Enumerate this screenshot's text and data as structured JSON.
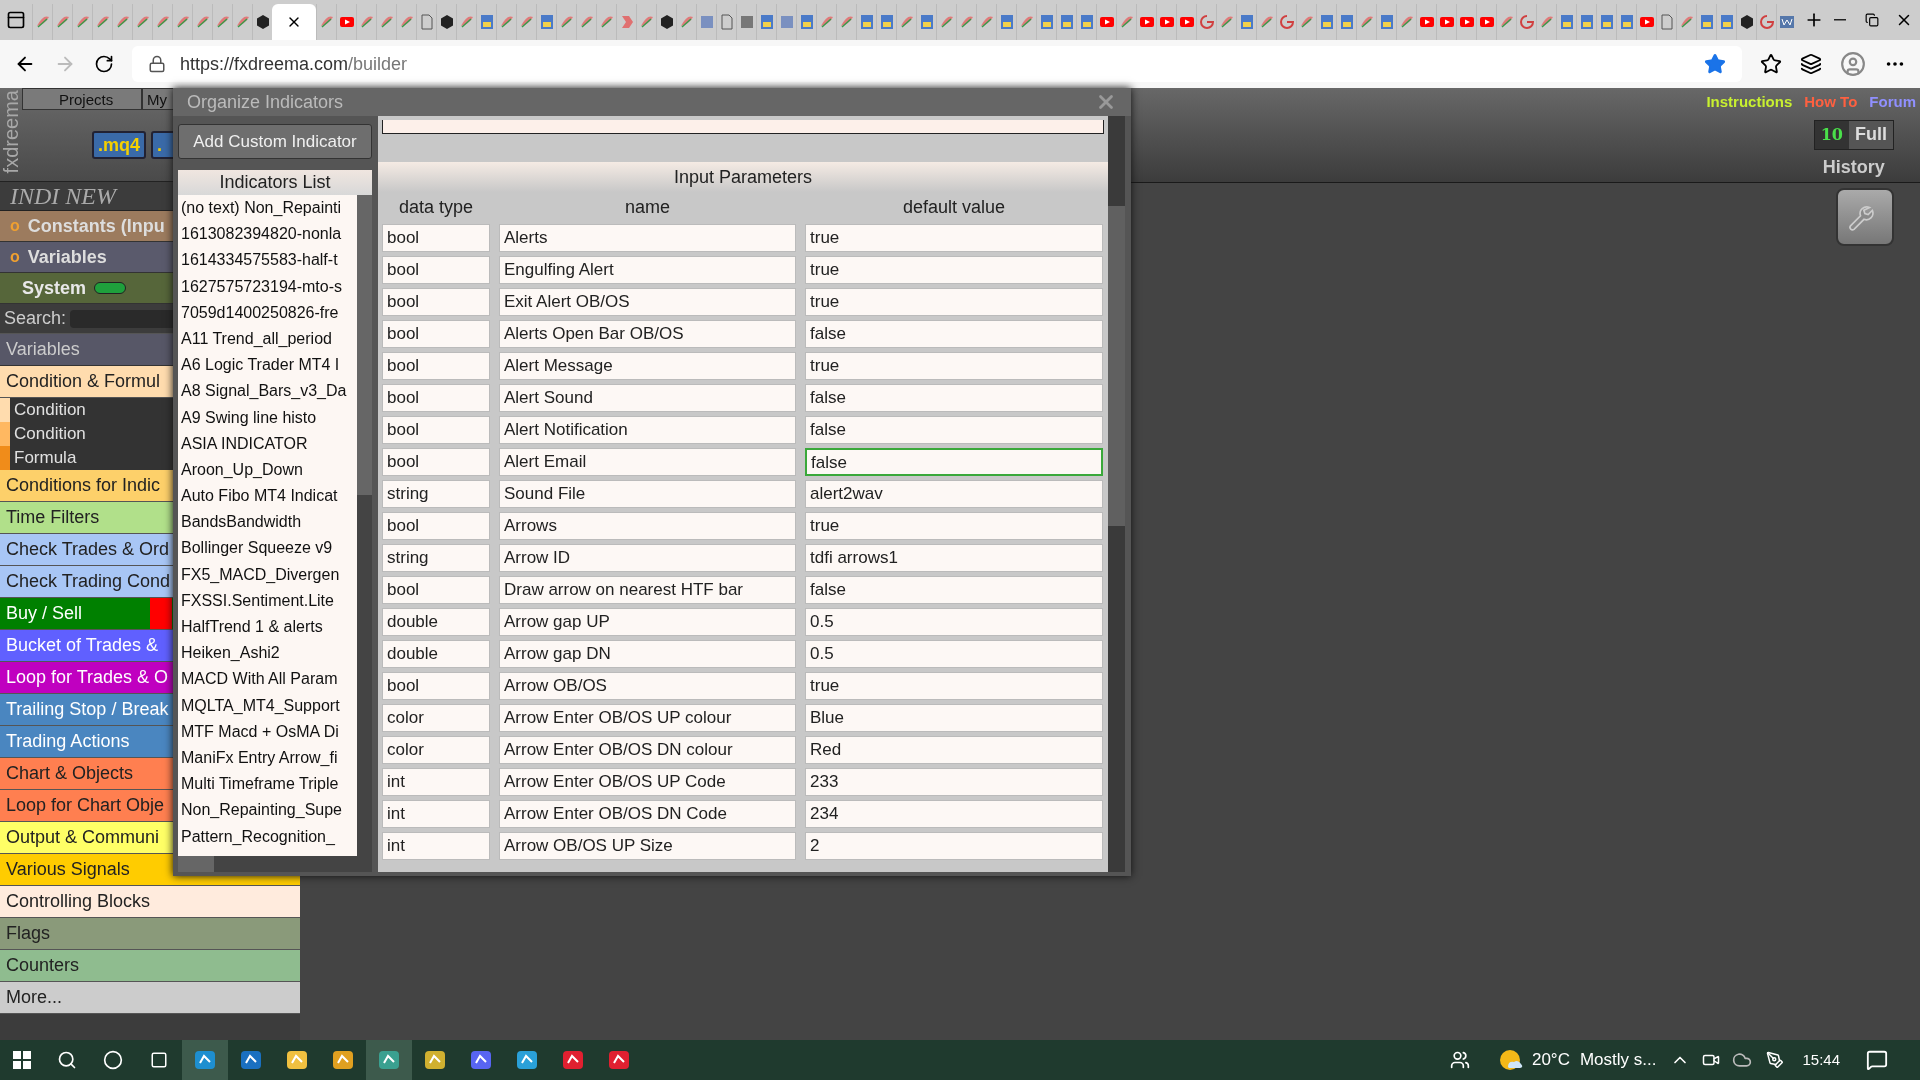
{
  "browser": {
    "url": {
      "origin": "https://fxdreema.com",
      "path": "/builder"
    }
  },
  "sidebar": {
    "brand": "fxdreema",
    "tabs": [
      {
        "label": "Projects"
      },
      {
        "label": "My"
      }
    ],
    "file_buttons": [
      ".mq4",
      "."
    ],
    "project_title": "INDI NEW",
    "sections": [
      {
        "marker": "o",
        "label": "Constants (Inpu",
        "color": "#9c7b5e"
      },
      {
        "marker": "o",
        "label": "Variables",
        "color": "#5a5a6c"
      }
    ],
    "system": {
      "label": "System",
      "on": true
    },
    "search": {
      "label": "Search:"
    },
    "variables_header": "Variables",
    "categories": [
      {
        "label": "Condition & Formul",
        "color": "#ffdcae",
        "children": [
          {
            "label": "Condition",
            "color": "#ffdcae"
          },
          {
            "label": "Condition",
            "color": "#ffb861"
          },
          {
            "label": "Formula",
            "color": "#f08c1a"
          }
        ]
      },
      {
        "label": "Conditions for Indic",
        "color": "#fdd06a"
      },
      {
        "label": "Time Filters",
        "color": "#b1e08a"
      },
      {
        "label": "Check Trades & Ord",
        "color": "#a8c6f5"
      },
      {
        "label": "Check Trading Cond",
        "color": "#a8c6f5"
      },
      {
        "label": "Buy / Sell",
        "color": "#008000",
        "flag": {
          "color": "#ff0000"
        }
      },
      {
        "label": "Bucket of Trades &",
        "color": "#6060ff"
      },
      {
        "label": "Loop for Trades & O",
        "color": "#c000c0"
      },
      {
        "label": "Trailing Stop / Break",
        "color": "#4a86c0"
      },
      {
        "label": "Trading Actions",
        "color": "#4a86c0"
      },
      {
        "label": "Chart & Objects",
        "color": "#ff7f50"
      },
      {
        "label": "Loop for Chart Obje",
        "color": "#ff7f50"
      },
      {
        "label": "Output & Communi",
        "color": "#ffff66"
      },
      {
        "label": "Various Signals",
        "color": "#ffcc00"
      },
      {
        "label": "Controlling Blocks",
        "color": "#ffebdd"
      },
      {
        "label": "Flags",
        "color": "#8a9a7a"
      },
      {
        "label": "Counters",
        "color": "#8fbc8f"
      },
      {
        "label": "More...",
        "color": "#cccccc"
      }
    ]
  },
  "toolbar": {
    "links": [
      {
        "label": "Instructions",
        "color": "#c8f030"
      },
      {
        "label": "How To",
        "color": "#ff6040"
      },
      {
        "label": "Forum",
        "color": "#9090ff"
      }
    ],
    "history_count": "10",
    "history_mode": "Full",
    "history_label": "History"
  },
  "dialog": {
    "title": "Organize Indicators",
    "add_button": "Add Custom Indicator",
    "list_title": "Indicators List",
    "indicators": [
      "(no text) Non_Repainti",
      "1613082394820-nonla",
      "1614334575583-half-t",
      "1627575723194-mto-s",
      "7059d1400250826-fre",
      "A11 Trend_all_period",
      "A6 Logic Trader MT4 I",
      "A8 Signal_Bars_v3_Da",
      "A9 Swing line histo",
      "ASIA INDICATOR",
      "Aroon_Up_Down",
      "Auto Fibo MT4 Indicat",
      "BandsBandwidth",
      "Bollinger Squeeze v9",
      "FX5_MACD_Divergen",
      "FXSSI.Sentiment.Lite",
      "HalfTrend 1 & alerts",
      "Heiken_Ashi2",
      "MACD With All Param",
      "MQLTA_MT4_Support",
      "MTF Macd + OsMA Di",
      "ManiFx Entry Arrow_fi",
      "Multi Timeframe Triple",
      "Non_Repainting_Supe",
      "Pattern_Recognition_"
    ],
    "params_title": "Input Parameters",
    "columns": [
      "data type",
      "name",
      "default value"
    ],
    "params": [
      {
        "type": "bool",
        "name": "Alerts",
        "default": "true",
        "focused": false
      },
      {
        "type": "bool",
        "name": "Engulfing Alert",
        "default": "true",
        "focused": false
      },
      {
        "type": "bool",
        "name": "Exit Alert OB/OS",
        "default": "true",
        "focused": false
      },
      {
        "type": "bool",
        "name": "Alerts Open Bar OB/OS",
        "default": "false",
        "focused": false
      },
      {
        "type": "bool",
        "name": "Alert Message",
        "default": "true",
        "focused": false
      },
      {
        "type": "bool",
        "name": "Alert Sound",
        "default": "false",
        "focused": false
      },
      {
        "type": "bool",
        "name": "Alert Notification",
        "default": "false",
        "focused": false
      },
      {
        "type": "bool",
        "name": "Alert Email",
        "default": "false",
        "focused": true
      },
      {
        "type": "string",
        "name": "Sound File",
        "default": "alert2wav",
        "focused": false
      },
      {
        "type": "bool",
        "name": "Arrows",
        "default": "true",
        "focused": false
      },
      {
        "type": "string",
        "name": "Arrow ID",
        "default": "tdfi arrows1",
        "focused": false
      },
      {
        "type": "bool",
        "name": "Draw arrow on nearest HTF bar",
        "default": "false",
        "focused": false
      },
      {
        "type": "double",
        "name": "Arrow gap UP",
        "default": "0.5",
        "focused": false
      },
      {
        "type": "double",
        "name": "Arrow gap DN",
        "default": "0.5",
        "focused": false
      },
      {
        "type": "bool",
        "name": "Arrow OB/OS",
        "default": "true",
        "focused": false
      },
      {
        "type": "color",
        "name": "Arrow Enter OB/OS UP colour",
        "default": "Blue",
        "focused": false
      },
      {
        "type": "color",
        "name": "Arrow Enter OB/OS DN colour",
        "default": "Red",
        "focused": false
      },
      {
        "type": "int",
        "name": "Arrow Enter OB/OS UP Code",
        "default": "233",
        "focused": false
      },
      {
        "type": "int",
        "name": "Arrow Enter OB/OS DN Code",
        "default": "234",
        "focused": false
      },
      {
        "type": "int",
        "name": "Arrow OB/OS UP Size",
        "default": "2",
        "focused": false
      }
    ]
  },
  "taskbar": {
    "weather": {
      "temperature": "20°C",
      "summary": "Mostly s..."
    },
    "clock": "15:44"
  }
}
